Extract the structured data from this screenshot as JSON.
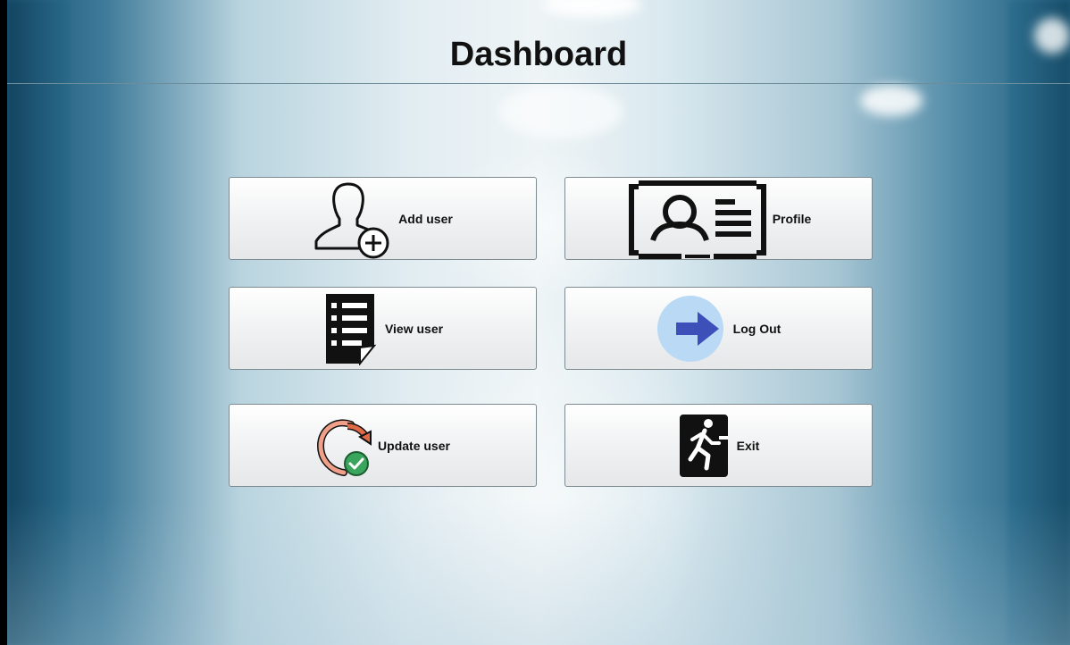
{
  "header": {
    "title": "Dashboard"
  },
  "tiles": [
    {
      "label": "Add user",
      "icon": "add-user-icon"
    },
    {
      "label": "Profile",
      "icon": "profile-card-icon"
    },
    {
      "label": "View user",
      "icon": "document-list-icon"
    },
    {
      "label": "Log Out",
      "icon": "arrow-right-icon"
    },
    {
      "label": "Update user",
      "icon": "refresh-check-icon"
    },
    {
      "label": "Exit",
      "icon": "running-exit-icon"
    }
  ],
  "colors": {
    "logout_circle": "#b9d9f5",
    "logout_arrow": "#3d4fb8",
    "update_arrow": "#e06a48",
    "update_check": "#3aa55d"
  }
}
